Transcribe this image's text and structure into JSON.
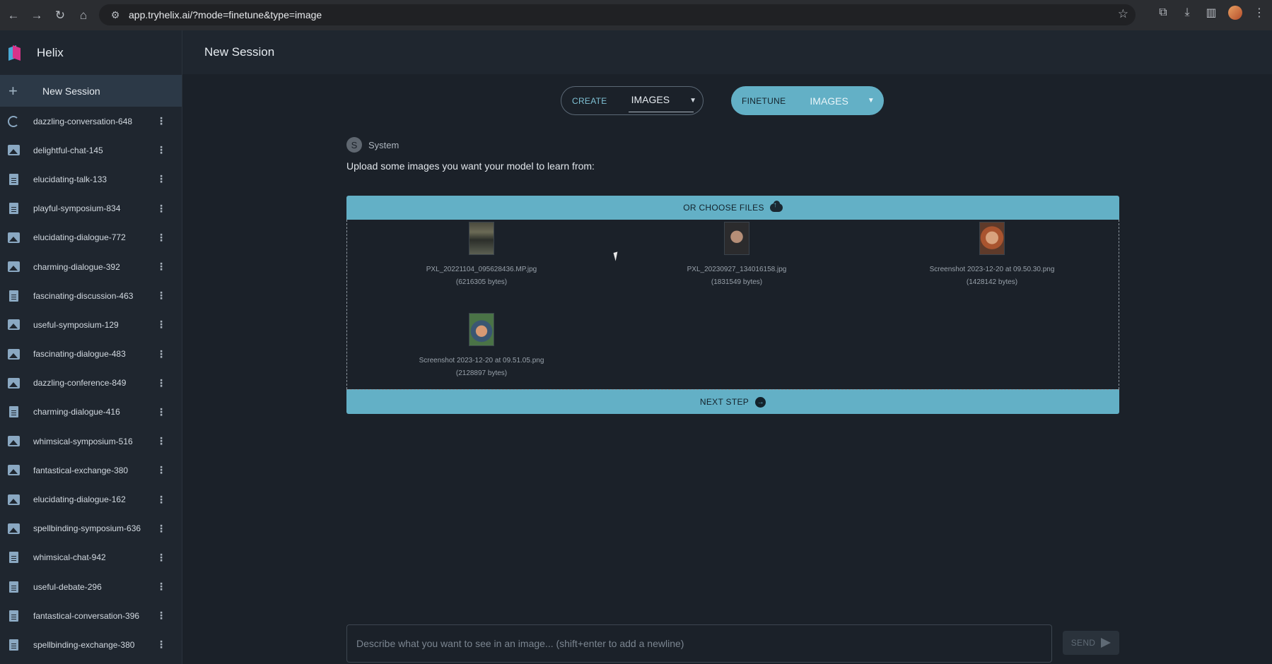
{
  "browser": {
    "url": "app.tryhelix.ai/?mode=finetune&type=image"
  },
  "sidebar": {
    "brand": "Helix",
    "new_session_label": "New Session",
    "sessions": [
      {
        "name": "dazzling-conversation-648",
        "icon": "finetune-icon"
      },
      {
        "name": "delightful-chat-145",
        "icon": "image-icon"
      },
      {
        "name": "elucidating-talk-133",
        "icon": "document-icon"
      },
      {
        "name": "playful-symposium-834",
        "icon": "document-icon"
      },
      {
        "name": "elucidating-dialogue-772",
        "icon": "image-icon"
      },
      {
        "name": "charming-dialogue-392",
        "icon": "image-icon"
      },
      {
        "name": "fascinating-discussion-463",
        "icon": "document-icon"
      },
      {
        "name": "useful-symposium-129",
        "icon": "image-icon"
      },
      {
        "name": "fascinating-dialogue-483",
        "icon": "image-icon"
      },
      {
        "name": "dazzling-conference-849",
        "icon": "image-icon"
      },
      {
        "name": "charming-dialogue-416",
        "icon": "document-icon"
      },
      {
        "name": "whimsical-symposium-516",
        "icon": "image-icon"
      },
      {
        "name": "fantastical-exchange-380",
        "icon": "image-icon"
      },
      {
        "name": "elucidating-dialogue-162",
        "icon": "image-icon"
      },
      {
        "name": "spellbinding-symposium-636",
        "icon": "image-icon"
      },
      {
        "name": "whimsical-chat-942",
        "icon": "document-icon"
      },
      {
        "name": "useful-debate-296",
        "icon": "document-icon"
      },
      {
        "name": "fantastical-conversation-396",
        "icon": "document-icon"
      },
      {
        "name": "spellbinding-exchange-380",
        "icon": "document-icon"
      }
    ]
  },
  "header": {
    "title": "New Session"
  },
  "mode_toggle": {
    "create": {
      "mode": "CREATE",
      "type": "IMAGES"
    },
    "finetune": {
      "mode": "FINETUNE",
      "type": "IMAGES"
    }
  },
  "message": {
    "sender_initial": "S",
    "sender": "System",
    "text": "Upload some images you want your model to learn from:"
  },
  "upload": {
    "choose_files_label": "OR CHOOSE FILES",
    "next_step_label": "NEXT STEP",
    "files": [
      {
        "name": "PXL_20221104_095628436.MP.jpg",
        "size": "(6216305 bytes)"
      },
      {
        "name": "PXL_20230927_134016158.jpg",
        "size": "(1831549 bytes)"
      },
      {
        "name": "Screenshot 2023-12-20 at 09.50.30.png",
        "size": "(1428142 bytes)"
      },
      {
        "name": "Screenshot 2023-12-20 at 09.51.05.png",
        "size": "(2128897 bytes)"
      }
    ]
  },
  "composer": {
    "placeholder": "Describe what you want to see in an image... (shift+enter to add a newline)",
    "send_label": "SEND"
  },
  "colors": {
    "accent": "#63b0c6",
    "background": "#1b2129",
    "sidebar": "#1f262f"
  }
}
